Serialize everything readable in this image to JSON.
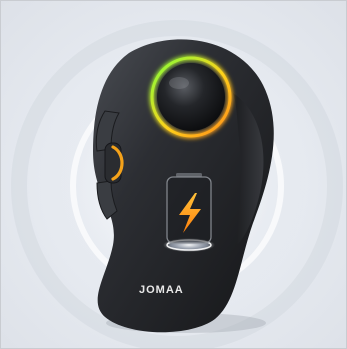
{
  "product": {
    "brand": "JOMAA"
  },
  "colors": {
    "background": "#e7ebf1",
    "mouse_body": "#2b2d31",
    "ball": "#1f2124",
    "glow_ring": [
      "#7fff3a",
      "#ffd21a",
      "#ff8a1a"
    ],
    "scroll_accent": "#f4a21a",
    "charge_bolt": "#ff9f1a",
    "charge_glow": "#ffffff"
  },
  "icons": {
    "battery": "battery-charging-icon",
    "bolt": "lightning-bolt-icon"
  }
}
